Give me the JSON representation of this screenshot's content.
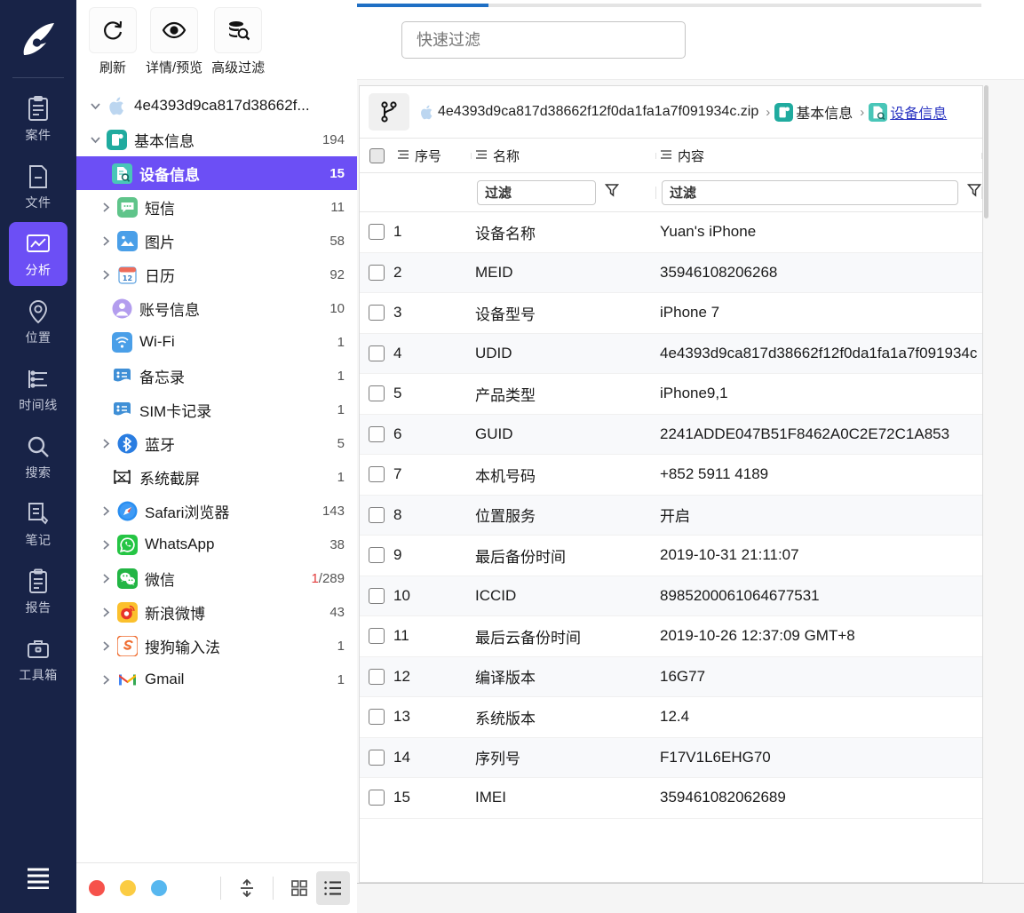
{
  "rail": {
    "logo_icon": "app-logo-icon",
    "items": [
      {
        "label": "案件",
        "icon": "clipboard-icon",
        "active": false
      },
      {
        "label": "文件",
        "icon": "file-icon",
        "active": false
      },
      {
        "label": "分析",
        "icon": "analysis-icon",
        "active": true
      },
      {
        "label": "位置",
        "icon": "location-pin-icon",
        "active": false
      },
      {
        "label": "时间线",
        "icon": "timeline-icon",
        "active": false
      },
      {
        "label": "搜索",
        "icon": "search-icon",
        "active": false
      },
      {
        "label": "笔记",
        "icon": "note-edit-icon",
        "active": false
      },
      {
        "label": "报告",
        "icon": "report-icon",
        "active": false
      },
      {
        "label": "工具箱",
        "icon": "toolbox-icon",
        "active": false
      }
    ],
    "menu_icon": "hamburger-menu-icon",
    "active_color": "#6c4ff5",
    "background": "#182347"
  },
  "toolbar": {
    "buttons": [
      {
        "label": "刷新",
        "icon": "refresh-icon"
      },
      {
        "label": "详情/预览",
        "icon": "eye-icon"
      },
      {
        "label": "高级过滤",
        "icon": "database-search-icon"
      }
    ]
  },
  "tree": {
    "nodes": [
      {
        "label": "4e4393d9ca817d38662f...",
        "count": "",
        "icon": "apple-icon",
        "level": 0,
        "caret": "down",
        "selected": false
      },
      {
        "label": "基本信息",
        "count": "194",
        "icon": "basicinfo-icon",
        "level": 0,
        "caret": "down",
        "selected": false
      },
      {
        "label": "设备信息",
        "count": "15",
        "icon": "deviceinfo-icon",
        "level": 2,
        "caret": "none",
        "selected": true
      },
      {
        "label": "短信",
        "count": "11",
        "icon": "sms-icon",
        "level": 1,
        "caret": "right",
        "selected": false
      },
      {
        "label": "图片",
        "count": "58",
        "icon": "image-icon",
        "level": 1,
        "caret": "right",
        "selected": false
      },
      {
        "label": "日历",
        "count": "92",
        "icon": "calendar-icon",
        "level": 1,
        "caret": "right",
        "selected": false
      },
      {
        "label": "账号信息",
        "count": "10",
        "icon": "account-icon",
        "level": 2,
        "caret": "none",
        "selected": false
      },
      {
        "label": "Wi-Fi",
        "count": "1",
        "icon": "wifi-icon",
        "level": 2,
        "caret": "none",
        "selected": false
      },
      {
        "label": "备忘录",
        "count": "1",
        "icon": "notes-icon",
        "level": 2,
        "caret": "none",
        "selected": false
      },
      {
        "label": "SIM卡记录",
        "count": "1",
        "icon": "simcard-icon",
        "level": 2,
        "caret": "none",
        "selected": false
      },
      {
        "label": "蓝牙",
        "count": "5",
        "icon": "bluetooth-icon",
        "level": 1,
        "caret": "right",
        "selected": false
      },
      {
        "label": "系统截屏",
        "count": "1",
        "icon": "screenshot-icon",
        "level": 2,
        "caret": "none",
        "selected": false
      },
      {
        "label": "Safari浏览器",
        "count": "143",
        "icon": "safari-icon",
        "level": 1,
        "caret": "right",
        "selected": false
      },
      {
        "label": "WhatsApp",
        "count": "38",
        "icon": "whatsapp-icon",
        "level": 1,
        "caret": "right",
        "selected": false
      },
      {
        "label": "微信",
        "count": "1/289",
        "unread": "1",
        "rest": "/289",
        "icon": "wechat-icon",
        "level": 1,
        "caret": "right",
        "selected": false
      },
      {
        "label": "新浪微博",
        "count": "43",
        "icon": "weibo-icon",
        "level": 1,
        "caret": "right",
        "selected": false
      },
      {
        "label": "搜狗输入法",
        "count": "1",
        "icon": "sogou-icon",
        "level": 1,
        "caret": "right",
        "selected": false
      },
      {
        "label": "Gmail",
        "count": "1",
        "icon": "gmail-icon",
        "level": 1,
        "caret": "right",
        "selected": false
      }
    ],
    "unread_color": "#e23c3c"
  },
  "tree_footer": {
    "tags": [
      {
        "name": "tag-red",
        "color": "#f6524b"
      },
      {
        "name": "tag-yellow",
        "color": "#fbcc43"
      },
      {
        "name": "tag-blue",
        "color": "#57b7ef"
      }
    ],
    "view_buttons": [
      {
        "name": "collapse-expand-icon",
        "active": false
      },
      {
        "name": "grid-view-icon",
        "active": false
      },
      {
        "name": "list-view-icon",
        "active": true
      }
    ]
  },
  "topbar": {
    "progress_percent": 21,
    "progress_color": "#1f6fc4",
    "quick_filter_placeholder": "快速过滤",
    "quick_filter_value": ""
  },
  "breadcrumb": {
    "branch_icon": "branch-icon",
    "items": [
      {
        "label": "4e4393d9ca817d38662f12f0da1fa1a7f091934c.zip",
        "icon": "apple-icon",
        "link": false
      },
      {
        "label": "基本信息",
        "icon": "basicinfo-icon",
        "link": false
      },
      {
        "label": "设备信息",
        "icon": "deviceinfo-icon",
        "link": true
      }
    ],
    "separator": "›"
  },
  "grid": {
    "columns": [
      {
        "label": "序号",
        "icon": "column-menu-icon"
      },
      {
        "label": "名称",
        "icon": "column-menu-icon"
      },
      {
        "label": "内容",
        "icon": "column-menu-icon"
      }
    ],
    "filter_placeholder": "过滤",
    "filter_name_value": "过滤",
    "filter_content_value": "过滤",
    "funnel_icon": "funnel-icon",
    "rows": [
      {
        "seq": "1",
        "name": "设备名称",
        "content": "Yuan's iPhone"
      },
      {
        "seq": "2",
        "name": "MEID",
        "content": "35946108206268"
      },
      {
        "seq": "3",
        "name": "设备型号",
        "content": "iPhone 7"
      },
      {
        "seq": "4",
        "name": "UDID",
        "content": "4e4393d9ca817d38662f12f0da1fa1a7f091934c"
      },
      {
        "seq": "5",
        "name": "产品类型",
        "content": "iPhone9,1"
      },
      {
        "seq": "6",
        "name": "GUID",
        "content": "2241ADDE047B51F8462A0C2E72C1A853"
      },
      {
        "seq": "7",
        "name": "本机号码",
        "content": "+852 5911 4189"
      },
      {
        "seq": "8",
        "name": "位置服务",
        "content": "开启"
      },
      {
        "seq": "9",
        "name": "最后备份时间",
        "content": "2019-10-31 21:11:07"
      },
      {
        "seq": "10",
        "name": "ICCID",
        "content": "8985200061064677531"
      },
      {
        "seq": "11",
        "name": "最后云备份时间",
        "content": "2019-10-26 12:37:09 GMT+8"
      },
      {
        "seq": "12",
        "name": "编译版本",
        "content": "16G77"
      },
      {
        "seq": "13",
        "name": "系统版本",
        "content": "12.4"
      },
      {
        "seq": "14",
        "name": "序列号",
        "content": "F17V1L6EHG70"
      },
      {
        "seq": "15",
        "name": "IMEI",
        "content": "359461082062689"
      }
    ]
  }
}
